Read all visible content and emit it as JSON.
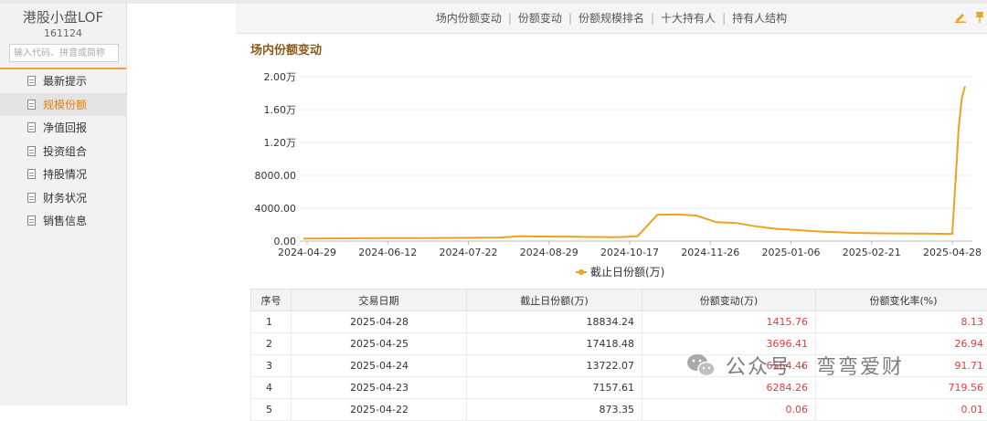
{
  "sidebar": {
    "fund_name": "港股小盘LOF",
    "fund_code": "161124",
    "search_placeholder": "输入代码、拼音或简称",
    "items": [
      {
        "label": "最新提示",
        "active": false
      },
      {
        "label": "规模份额",
        "active": true
      },
      {
        "label": "净值回报",
        "active": false
      },
      {
        "label": "投资组合",
        "active": false
      },
      {
        "label": "持股情况",
        "active": false
      },
      {
        "label": "财务状况",
        "active": false
      },
      {
        "label": "销售信息",
        "active": false
      }
    ]
  },
  "nav": {
    "tabs": [
      "场内份额变动",
      "份额变动",
      "份额规模排名",
      "十大持有人",
      "持有人结构"
    ],
    "separator": "|"
  },
  "section_title": "场内份额变动",
  "chart_data": {
    "type": "line",
    "y_tick_labels": [
      "0.00",
      "4000.00",
      "8000.00",
      "1.20万",
      "1.60万",
      "2.00万"
    ],
    "ylim": [
      0,
      20000
    ],
    "x_tick_labels": [
      "2024-04-29",
      "2024-06-12",
      "2024-07-22",
      "2024-08-29",
      "2024-10-17",
      "2024-11-26",
      "2025-01-06",
      "2025-02-21",
      "2025-04-28"
    ],
    "legend": "截止日份额(万)",
    "legend_position": "bottom",
    "grid": true,
    "line_color": "#f0a020",
    "series": [
      {
        "name": "截止日份额(万)",
        "values": [
          300,
          320,
          330,
          340,
          350,
          360,
          370,
          380,
          390,
          420,
          430,
          600,
          560,
          540,
          520,
          500,
          480,
          600,
          3200,
          3250,
          3100,
          2300,
          2200,
          1800,
          1500,
          1350,
          1200,
          1100,
          1000,
          950,
          930,
          920,
          900,
          873.35,
          7157.61,
          13722.07,
          17418.48,
          18834.24
        ]
      }
    ]
  },
  "table": {
    "headers": [
      "序号",
      "交易日期",
      "截止日份额(万)",
      "份额变动(万)",
      "份额变化率(%)"
    ],
    "rows": [
      {
        "no": "1",
        "date": "2025-04-28",
        "shares": "18834.24",
        "change": "1415.76",
        "rate": "8.13"
      },
      {
        "no": "2",
        "date": "2025-04-25",
        "shares": "17418.48",
        "change": "3696.41",
        "rate": "26.94"
      },
      {
        "no": "3",
        "date": "2025-04-24",
        "shares": "13722.07",
        "change": "6564.46",
        "rate": "91.71"
      },
      {
        "no": "4",
        "date": "2025-04-23",
        "shares": "7157.61",
        "change": "6284.26",
        "rate": "719.56"
      },
      {
        "no": "5",
        "date": "2025-04-22",
        "shares": "873.35",
        "change": "0.06",
        "rate": "0.01"
      }
    ]
  },
  "watermark": {
    "text": "公众号 · 弯弯爱财",
    "icon": "wechat-icon"
  },
  "colors": {
    "accent": "#e98000",
    "negative_red": "#e23b3b"
  }
}
